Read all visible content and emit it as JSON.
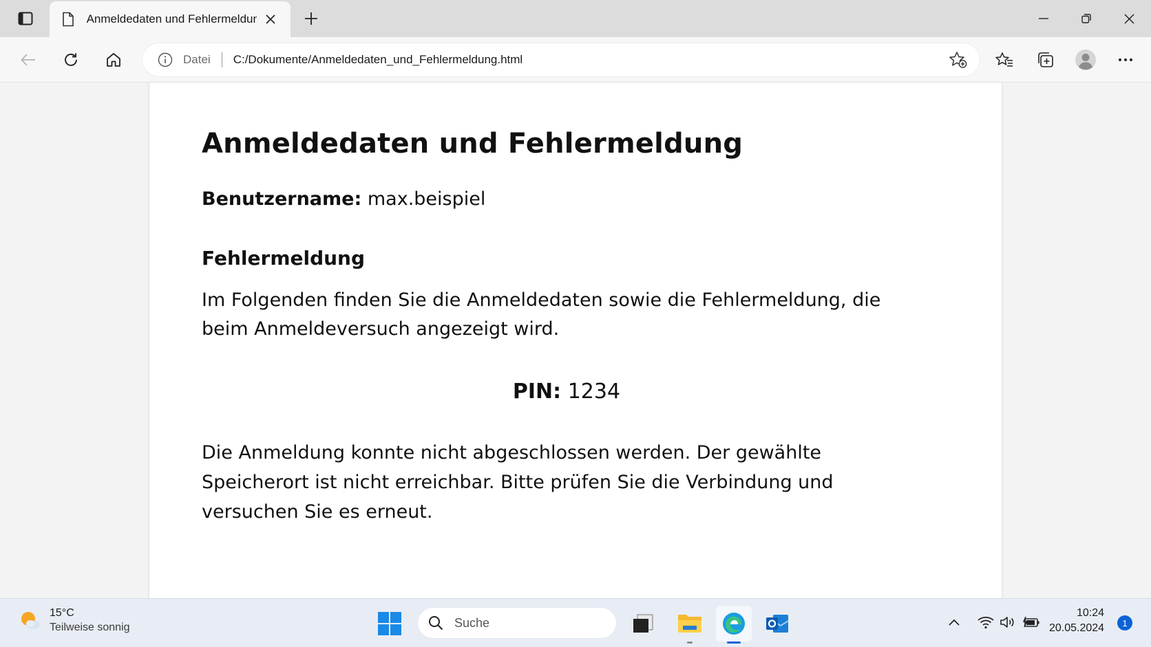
{
  "browser": {
    "tab": {
      "title": "Anmeldedaten und Fehlermeldung",
      "icon": "document-icon"
    },
    "address": {
      "scheme_label": "Datei",
      "url": "C:/Dokumente/Anmeldedaten_und_Fehlermeldung.html"
    }
  },
  "page": {
    "title": "Anmeldedaten und Fehlermeldung",
    "username_label": "Benutzername:",
    "username_value": "max.beispiel",
    "section_heading": "Fehlermeldung",
    "intro": "Im Folgenden finden Sie die Anmeldedaten sowie die Fehlermeldung, die beim Anmeldeversuch angezeigt wird.",
    "pin_label": "PIN:",
    "pin_value": "1234",
    "error_text": "Die Anmeldung konnte nicht abgeschlossen werden. Der gewählte Speicherort ist nicht erreichbar. Bitte prüfen Sie die Verbindung und versuchen Sie es erneut."
  },
  "taskbar": {
    "weather": {
      "temp": "15°C",
      "condition": "Teilweise sonnig"
    },
    "search_placeholder": "Suche",
    "apps": [
      "windows-start",
      "file-manager",
      "file-explorer",
      "edge",
      "outlook"
    ],
    "clock": {
      "time": "10:24",
      "date": "20.05.2024"
    },
    "notification_count": "1"
  },
  "colors": {
    "accent": "#0a63d6",
    "page_bg": "#ffffff",
    "chrome_bg": "#f7f7f7",
    "titlebar_bg": "#dcdcdc",
    "taskbar_bg": "#e8edf5"
  }
}
